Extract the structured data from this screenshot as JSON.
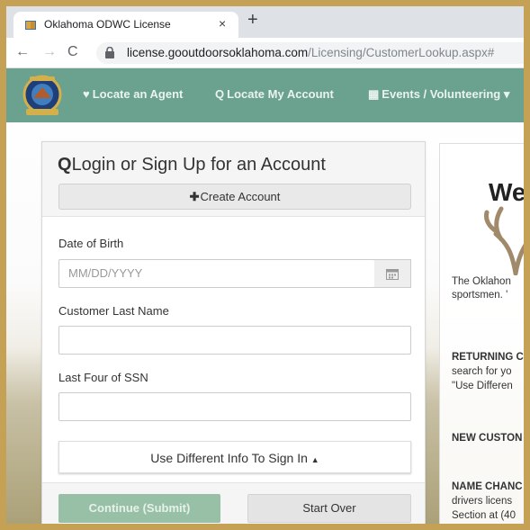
{
  "browser": {
    "tab_title": "Oklahoma ODWC License",
    "tab_close": "×",
    "new_tab": "+",
    "url_host": "license.gooutdoorsoklahoma.com",
    "url_path": "/Licensing/CustomerLookup.aspx#"
  },
  "site_nav": {
    "locate_agent": "Locate an Agent",
    "locate_account": "Locate My Account",
    "events": "Events / Volunteering"
  },
  "login": {
    "title": "Login or Sign Up for an Account",
    "create_account": "Create Account",
    "dob_label": "Date of Birth",
    "dob_placeholder": "MM/DD/YYYY",
    "last_name_label": "Customer Last Name",
    "ssn_label": "Last Four of SSN",
    "different_info": "Use Different Info To Sign In",
    "continue": "Continue (Submit)",
    "start_over": "Start Over"
  },
  "welcome": {
    "title": "We",
    "line1": "The Oklahon",
    "line2": "sportsmen. '",
    "line3": "RETURNING C",
    "line4": "search for yo",
    "line5": "\"Use Differen",
    "line6": "NEW CUSTON",
    "line7": "NAME CHANC",
    "line8": "drivers licens",
    "line9": "Section at (40"
  },
  "colors": {
    "site_nav_bg": "#6ba18f",
    "continue_bg": "#97c0a6",
    "frame": "#c4a154"
  }
}
